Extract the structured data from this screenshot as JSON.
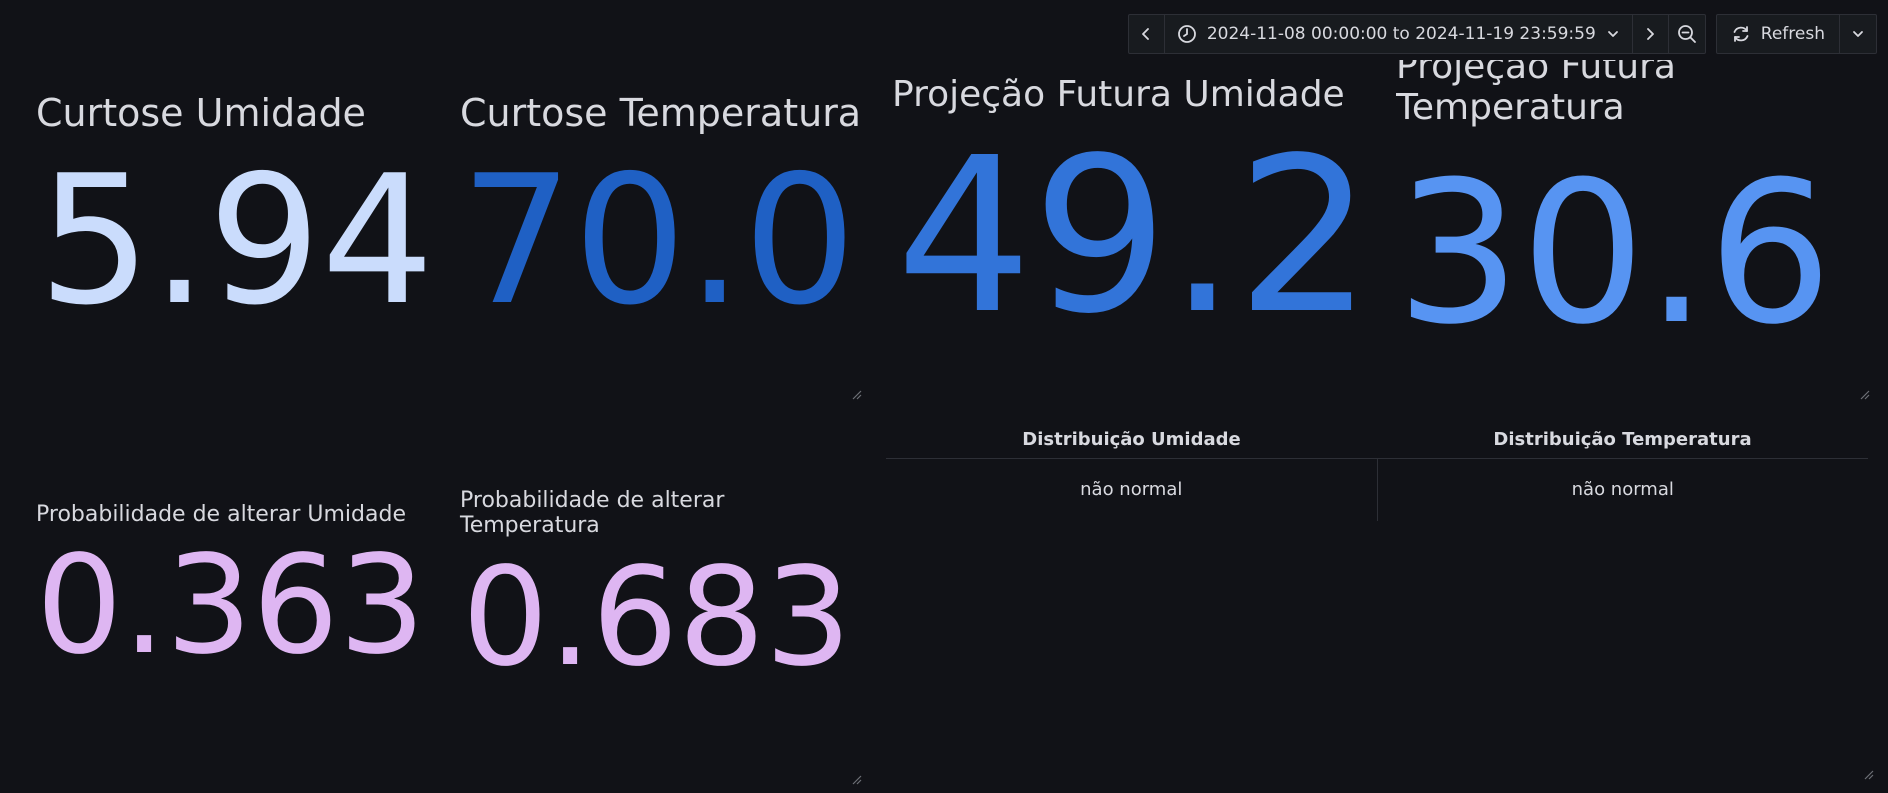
{
  "toolbar": {
    "time_range": "2024-11-08 00:00:00 to 2024-11-19 23:59:59",
    "refresh_label": "Refresh"
  },
  "panels": {
    "curtose_umidade": {
      "title": "Curtose Umidade",
      "value": "5.94",
      "color": "#cadcfc"
    },
    "curtose_temperatura": {
      "title": "Curtose Temperatura",
      "value": "70.0",
      "color": "#1f60c4"
    },
    "projecao_umidade": {
      "title": "Projeção Futura Umidade",
      "value": "49.2",
      "color": "#3274d9"
    },
    "projecao_temperatura": {
      "title_line1": "Projeção Futura",
      "title_line2": "Temperatura",
      "value": "30.6",
      "color": "#5794f2"
    },
    "prob_umidade": {
      "title": "Probabilidade de alterar Umidade",
      "value": "0.363",
      "color": "#deb6f2"
    },
    "prob_temperatura": {
      "title_line1": "Probabilidade de alterar",
      "title_line2": "Temperatura",
      "value": "0.683",
      "color": "#deb6f2"
    }
  },
  "distribution_table": {
    "columns": [
      "Distribuição Umidade",
      "Distribuição Temperatura"
    ],
    "rows": [
      [
        "não normal",
        "não normal"
      ]
    ]
  }
}
